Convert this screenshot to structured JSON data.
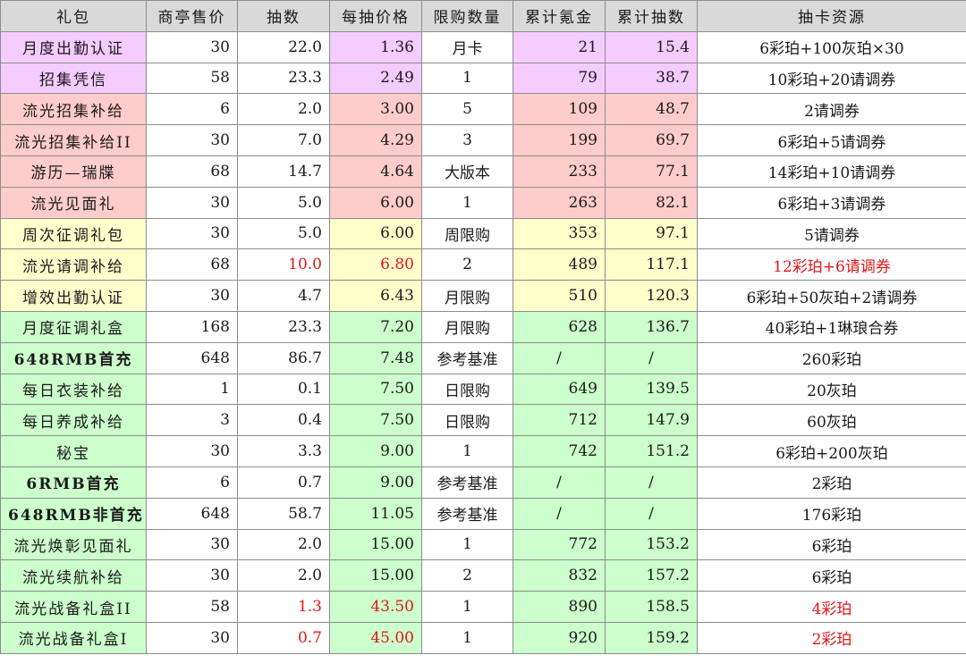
{
  "headers": [
    "礼包",
    "商亭售价",
    "抽数",
    "每抽价格",
    "限购数量",
    "累计氪金",
    "累计抽数",
    "抽卡资源"
  ],
  "rows": [
    {
      "name": "月度出勤认证",
      "bold": false,
      "group": "purple",
      "price": "30",
      "draws": "22.0",
      "per": "1.36",
      "limit": "月卡",
      "cost": "21",
      "total": "15.4",
      "res": "6彩珀+100灰珀×30",
      "red": []
    },
    {
      "name": "招集凭信",
      "bold": false,
      "group": "purple",
      "price": "58",
      "draws": "23.3",
      "per": "2.49",
      "limit": "1",
      "cost": "79",
      "total": "38.7",
      "res": "10彩珀+20请调券",
      "red": []
    },
    {
      "name": "流光招集补给",
      "bold": false,
      "group": "pink",
      "price": "6",
      "draws": "2.0",
      "per": "3.00",
      "limit": "5",
      "cost": "109",
      "total": "48.7",
      "res": "2请调券",
      "red": []
    },
    {
      "name": "流光招集补给II",
      "bold": false,
      "group": "pink",
      "price": "30",
      "draws": "7.0",
      "per": "4.29",
      "limit": "3",
      "cost": "199",
      "total": "69.7",
      "res": "6彩珀+5请调券",
      "red": []
    },
    {
      "name": "游历—瑞牒",
      "bold": false,
      "group": "pink",
      "price": "68",
      "draws": "14.7",
      "per": "4.64",
      "limit": "大版本",
      "cost": "233",
      "total": "77.1",
      "res": "14彩珀+10请调券",
      "red": []
    },
    {
      "name": "流光见面礼",
      "bold": false,
      "group": "pink",
      "price": "30",
      "draws": "5.0",
      "per": "6.00",
      "limit": "1",
      "cost": "263",
      "total": "82.1",
      "res": "6彩珀+3请调券",
      "red": []
    },
    {
      "name": "周次征调礼包",
      "bold": false,
      "group": "yellow",
      "price": "30",
      "draws": "5.0",
      "per": "6.00",
      "limit": "周限购",
      "cost": "353",
      "total": "97.1",
      "res": "5请调券",
      "red": []
    },
    {
      "name": "流光请调补给",
      "bold": false,
      "group": "yellow",
      "price": "68",
      "draws": "10.0",
      "per": "6.80",
      "limit": "2",
      "cost": "489",
      "total": "117.1",
      "res": "12彩珀+6请调券",
      "red": [
        "draws",
        "per",
        "res"
      ]
    },
    {
      "name": "增效出勤认证",
      "bold": false,
      "group": "yellow",
      "price": "30",
      "draws": "4.7",
      "per": "6.43",
      "limit": "月限购",
      "cost": "510",
      "total": "120.3",
      "res": "6彩珀+50灰珀+2请调券",
      "red": []
    },
    {
      "name": "月度征调礼盒",
      "bold": false,
      "group": "green",
      "price": "168",
      "draws": "23.3",
      "per": "7.20",
      "limit": "月限购",
      "cost": "628",
      "total": "136.7",
      "res": "40彩珀+1琳琅合券",
      "red": []
    },
    {
      "name": "648RMB首充",
      "bold": true,
      "group": "green",
      "price": "648",
      "draws": "86.7",
      "per": "7.48",
      "limit": "参考基准",
      "cost": "/",
      "total": "/",
      "res": "260彩珀",
      "red": []
    },
    {
      "name": "每日衣装补给",
      "bold": false,
      "group": "green",
      "price": "1",
      "draws": "0.1",
      "per": "7.50",
      "limit": "日限购",
      "cost": "649",
      "total": "139.5",
      "res": "20灰珀",
      "red": []
    },
    {
      "name": "每日养成补给",
      "bold": false,
      "group": "green",
      "price": "3",
      "draws": "0.4",
      "per": "7.50",
      "limit": "日限购",
      "cost": "712",
      "total": "147.9",
      "res": "60灰珀",
      "red": []
    },
    {
      "name": "秘宝",
      "bold": false,
      "group": "green",
      "price": "30",
      "draws": "3.3",
      "per": "9.00",
      "limit": "1",
      "cost": "742",
      "total": "151.2",
      "res": "6彩珀+200灰珀",
      "red": []
    },
    {
      "name": "6RMB首充",
      "bold": true,
      "group": "green",
      "price": "6",
      "draws": "0.7",
      "per": "9.00",
      "limit": "参考基准",
      "cost": "/",
      "total": "/",
      "res": "2彩珀",
      "red": []
    },
    {
      "name": "648RMB非首充",
      "bold": true,
      "group": "green",
      "price": "648",
      "draws": "58.7",
      "per": "11.05",
      "limit": "参考基准",
      "cost": "/",
      "total": "/",
      "res": "176彩珀",
      "red": []
    },
    {
      "name": "流光焕彰见面礼",
      "bold": false,
      "group": "green",
      "price": "30",
      "draws": "2.0",
      "per": "15.00",
      "limit": "1",
      "cost": "772",
      "total": "153.2",
      "res": "6彩珀",
      "red": []
    },
    {
      "name": "流光续航补给",
      "bold": false,
      "group": "green",
      "price": "30",
      "draws": "2.0",
      "per": "15.00",
      "limit": "2",
      "cost": "832",
      "total": "157.2",
      "res": "6彩珀",
      "red": []
    },
    {
      "name": "流光战备礼盒II",
      "bold": false,
      "group": "green",
      "price": "58",
      "draws": "1.3",
      "per": "43.50",
      "limit": "1",
      "cost": "890",
      "total": "158.5",
      "res": "4彩珀",
      "red": [
        "draws",
        "per",
        "res"
      ]
    },
    {
      "name": "流光战备礼盒I",
      "bold": false,
      "group": "green",
      "price": "30",
      "draws": "0.7",
      "per": "45.00",
      "limit": "1",
      "cost": "920",
      "total": "159.2",
      "res": "2彩珀",
      "red": [
        "draws",
        "per",
        "res"
      ]
    }
  ]
}
